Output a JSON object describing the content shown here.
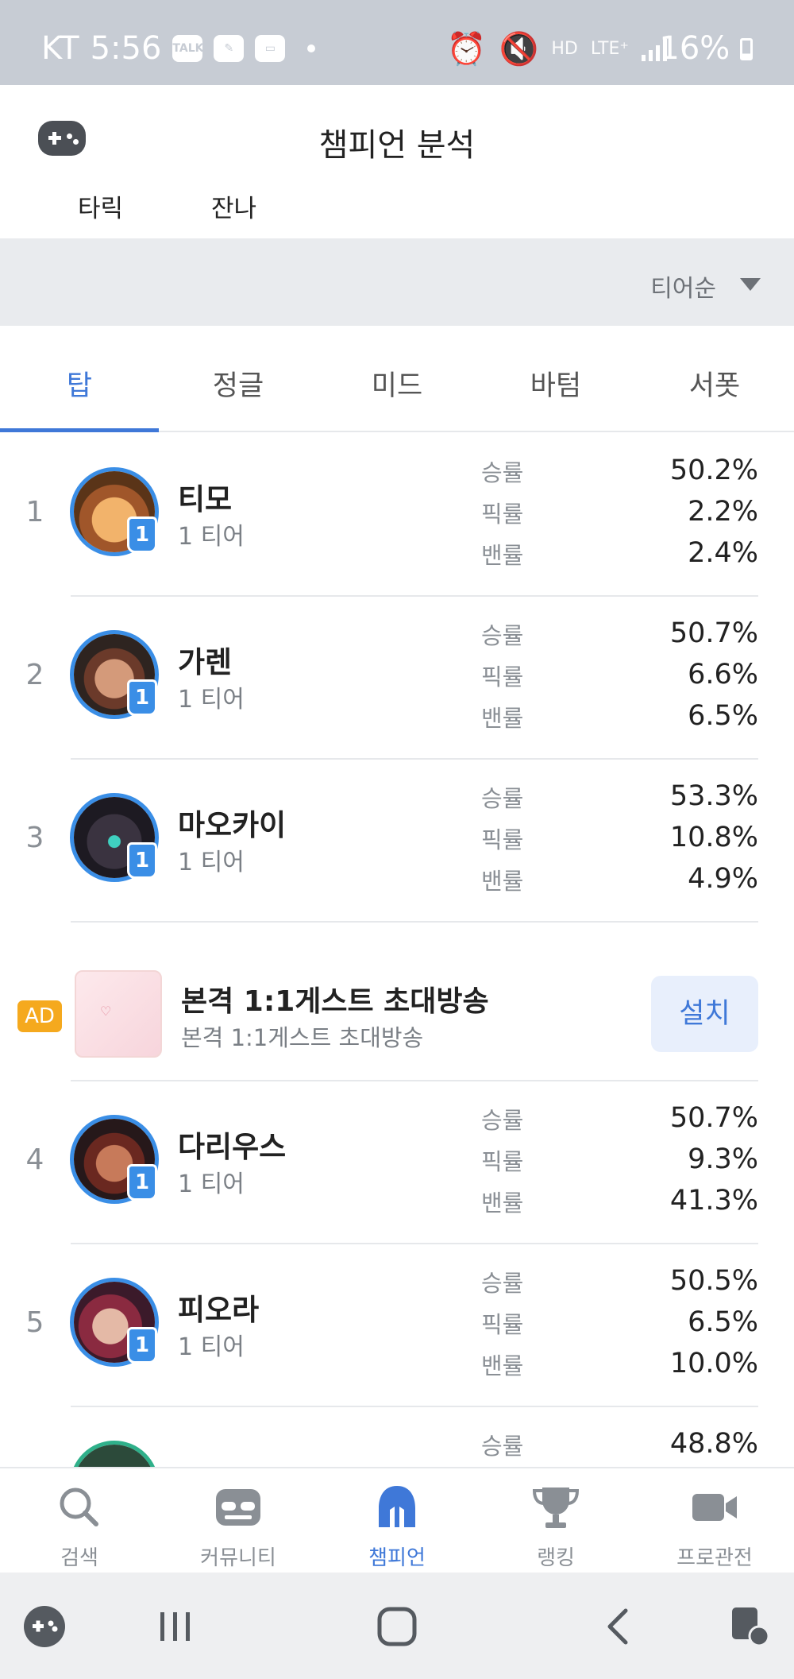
{
  "status_bar": {
    "carrier": "KT",
    "time": "5:56",
    "network": "LTE⁺",
    "battery": "16%",
    "icons": [
      "talk-icon",
      "pen-icon",
      "twitch-icon",
      "alarm-icon",
      "mute-icon",
      "hd-icon",
      "signal-icon",
      "battery-icon"
    ]
  },
  "header": {
    "title": "챔피언 분석",
    "sub_tabs": [
      "타릭",
      "잔나"
    ]
  },
  "sort": {
    "label": "티어순"
  },
  "position_tabs": [
    "탑",
    "정글",
    "미드",
    "바텀",
    "서폿"
  ],
  "active_position": "탑",
  "stat_labels": {
    "win": "승률",
    "pick": "픽률",
    "ban": "밴률"
  },
  "champions": [
    {
      "rank": "1",
      "name": "티모",
      "tier": "1 티어",
      "tier_badge": "1",
      "win": "50.2%",
      "pick": "2.2%",
      "ban": "2.4%"
    },
    {
      "rank": "2",
      "name": "가렌",
      "tier": "1 티어",
      "tier_badge": "1",
      "win": "50.7%",
      "pick": "6.6%",
      "ban": "6.5%"
    },
    {
      "rank": "3",
      "name": "마오카이",
      "tier": "1 티어",
      "tier_badge": "1",
      "win": "53.3%",
      "pick": "10.8%",
      "ban": "4.9%"
    },
    {
      "rank": "4",
      "name": "다리우스",
      "tier": "1 티어",
      "tier_badge": "1",
      "win": "50.7%",
      "pick": "9.3%",
      "ban": "41.3%"
    },
    {
      "rank": "5",
      "name": "피오라",
      "tier": "1 티어",
      "tier_badge": "1",
      "win": "50.5%",
      "pick": "6.5%",
      "ban": "10.0%"
    },
    {
      "win": "48.8%"
    }
  ],
  "ad": {
    "badge": "AD",
    "title": "본격 1:1게스트 초대방송",
    "subtitle": "본격 1:1게스트 초대방송",
    "button": "설치"
  },
  "bottom_nav": [
    {
      "label": "검색",
      "icon": "search-icon"
    },
    {
      "label": "커뮤니티",
      "icon": "community-icon"
    },
    {
      "label": "챔피언",
      "icon": "champion-helmet-icon",
      "active": true
    },
    {
      "label": "랭킹",
      "icon": "trophy-icon"
    },
    {
      "label": "프로관전",
      "icon": "video-camera-icon"
    }
  ],
  "colors": {
    "accent": "#3f78d8",
    "tier_badge": "#3a8ee6",
    "ad_badge": "#f5a91e",
    "status_bar": "#c7ccd4"
  }
}
